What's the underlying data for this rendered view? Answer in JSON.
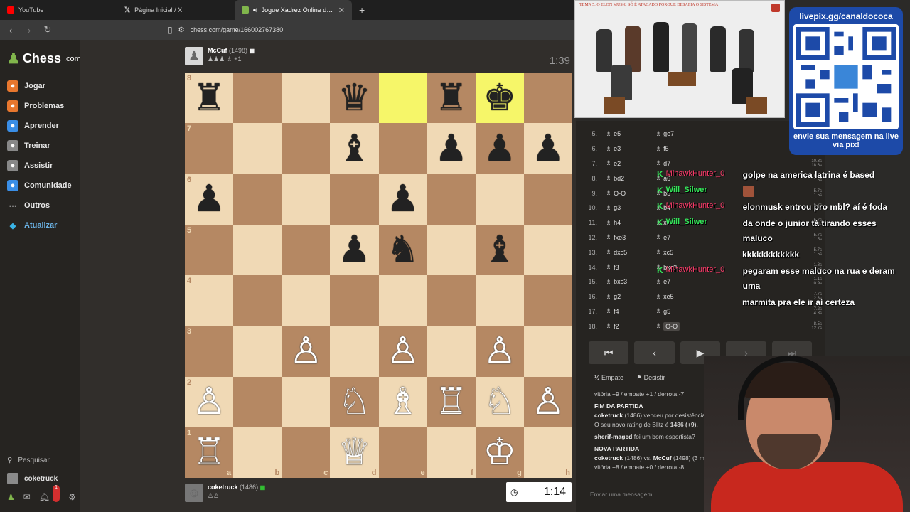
{
  "browser": {
    "tabs": [
      {
        "title": "YouTube",
        "fav_color": "#ff0000"
      },
      {
        "title": "Página Inicial / X",
        "fav_color": "#000000"
      },
      {
        "title": "Jogue Xadrez Online de GRA",
        "fav_color": "#81b64c"
      }
    ],
    "url": "chess.com/game/166002767380"
  },
  "sidebar": {
    "logo_text": "Chess",
    "logo_suffix": ".com",
    "items": [
      {
        "label": "Jogar",
        "icon": "play-icon",
        "color": "#e8772e"
      },
      {
        "label": "Problemas",
        "icon": "puzzle-icon",
        "color": "#e8772e"
      },
      {
        "label": "Aprender",
        "icon": "learn-icon",
        "color": "#3a8ee6"
      },
      {
        "label": "Treinar",
        "icon": "train-icon",
        "color": "#888888"
      },
      {
        "label": "Assistir",
        "icon": "watch-icon",
        "color": "#888888"
      },
      {
        "label": "Comunidade",
        "icon": "community-icon",
        "color": "#3a8ee6"
      },
      {
        "label": "Outros",
        "icon": "more-icon",
        "color": "#888888"
      },
      {
        "label": "Atualizar",
        "icon": "diamond-icon",
        "color": "#3ab4e6"
      }
    ],
    "search_label": "Pesquisar",
    "user_label": "coketruck",
    "notif_count": "1"
  },
  "top_player": {
    "name": "McCuf",
    "rating": "(1498)",
    "captured": "+1",
    "clock": "1:39"
  },
  "bottom_player": {
    "name": "coketruck",
    "rating": "(1486)",
    "clock": "1:14"
  },
  "board": {
    "ranks": [
      "8",
      "7",
      "6",
      "5",
      "4",
      "3",
      "2",
      "1"
    ],
    "files": [
      "a",
      "b",
      "c",
      "d",
      "e",
      "f",
      "g",
      "h"
    ],
    "position": [
      [
        "♜",
        "",
        "",
        "♛",
        "",
        "♜",
        "♚",
        ""
      ],
      [
        "",
        "",
        "",
        "♝",
        "",
        "♟",
        "♟",
        "♟"
      ],
      [
        "♟",
        "",
        "",
        "",
        "♟",
        "",
        "",
        ""
      ],
      [
        "",
        "",
        "",
        "♟",
        "♞",
        "",
        "♝",
        ""
      ],
      [
        "",
        "",
        "",
        "",
        "",
        "",
        "",
        ""
      ],
      [
        "",
        "",
        "♙",
        "",
        "♙",
        "",
        "♙",
        ""
      ],
      [
        "♙",
        "",
        "",
        "♘",
        "♗",
        "♖",
        "♘",
        "♙"
      ],
      [
        "♖",
        "",
        "",
        "♕",
        "",
        "",
        "♔",
        ""
      ]
    ],
    "highlight": [
      [
        0,
        4
      ],
      [
        0,
        6
      ]
    ]
  },
  "moves": [
    {
      "num": "5.",
      "white": "e5",
      "black": "ge7"
    },
    {
      "num": "6.",
      "white": "e3",
      "black": "f5"
    },
    {
      "num": "7.",
      "white": "e2",
      "black": "d7"
    },
    {
      "num": "8.",
      "white": "bd2",
      "black": "a6"
    },
    {
      "num": "9.",
      "white": "O-O",
      "black": "b5"
    },
    {
      "num": "10.",
      "white": "g3",
      "black": "b4"
    },
    {
      "num": "11.",
      "white": "h4",
      "black": "xe4"
    },
    {
      "num": "12.",
      "white": "fxe3",
      "black": "e7"
    },
    {
      "num": "13.",
      "white": "dxc5",
      "black": "xc5"
    },
    {
      "num": "14.",
      "white": "f3",
      "black": "bxc3"
    },
    {
      "num": "15.",
      "white": "bxc3",
      "black": "e7"
    },
    {
      "num": "16.",
      "white": "g2",
      "black": "xe5"
    },
    {
      "num": "17.",
      "white": "f4",
      "black": "g5"
    },
    {
      "num": "18.",
      "white": "f2",
      "black": "O-O"
    }
  ],
  "move_times": [
    [
      "10.3s",
      "18.6s"
    ],
    [
      "5.7s",
      "1.5s"
    ],
    [
      "5.7s",
      "1.5s"
    ],
    [
      "5.7s",
      "1.5s"
    ],
    [
      "5.7s",
      "1.5s"
    ],
    [
      "5.7s",
      "1.5s"
    ],
    [
      "5.7s",
      "1.5s"
    ],
    [
      "1.8s",
      "1.5s"
    ],
    [
      "1.1s",
      "0.9s"
    ],
    [
      "7.7s",
      "2.3s"
    ],
    [
      "7.2s",
      "4.3s"
    ],
    [
      "8.5s",
      "12.7s"
    ]
  ],
  "controls": {
    "draw_label": "Empate",
    "draw_prefix": "½",
    "resign_label": "Desistir"
  },
  "log": {
    "record": "vitória +9 / empate +1 / derrota -7",
    "end_title": "FIM DA PARTIDA",
    "end_text_user": "coketruck",
    "end_text": " (1486) venceu por desistência (3 min Com Ra",
    "rating_text": "O seu novo rating de Blitz é ",
    "rating_value": "1486 (+9).",
    "feedback_user": "sherif-maged",
    "feedback_text": " foi um bom esportista?",
    "new_title": "NOVA PARTIDA",
    "new_text_user": "coketruck",
    "new_text": " (1486) vs. ",
    "new_text_opp": "McCuf",
    "new_text_tail": " (1498) (3 min)",
    "record2": "vitória +8 / empate +0 / derrota -8",
    "chat_placeholder": "Enviar uma mensagem..."
  },
  "stream": {
    "video_caption": "TEMA 5: O ELON MUSK, SÓ É ATACADO PORQUE DESAFIA O SISTEMA",
    "qr_title": "livepix.gg/canaldococa",
    "qr_foot": "envie sua mensagem na live via pix!",
    "chat": [
      {
        "user": "MihawkHunter_0",
        "color": "red",
        "text": "golpe na america latrina é based"
      },
      {
        "user": "Will_Silwer",
        "color": "green",
        "text": ""
      },
      {
        "user": "MihawkHunter_0",
        "color": "red",
        "text": "elonmusk entrou pro mbl? aí é foda"
      },
      {
        "user": "Will_Silwer",
        "color": "green",
        "text": "da onde o junior tá tirando esses maluco"
      },
      {
        "user": "",
        "color": "green",
        "text": "kkkkkkkkkkkk"
      },
      {
        "user": "MihawkHunter_0",
        "color": "red",
        "text": "pegaram esse maluco na rua e deram uma"
      },
      {
        "user": "",
        "color": "red",
        "text": "marmita pra ele ir aí certeza"
      }
    ]
  },
  "colors": {
    "light_square": "#f0d9b5",
    "dark_square": "#b58863",
    "highlight": "#f6f669",
    "accent": "#81b64c"
  }
}
